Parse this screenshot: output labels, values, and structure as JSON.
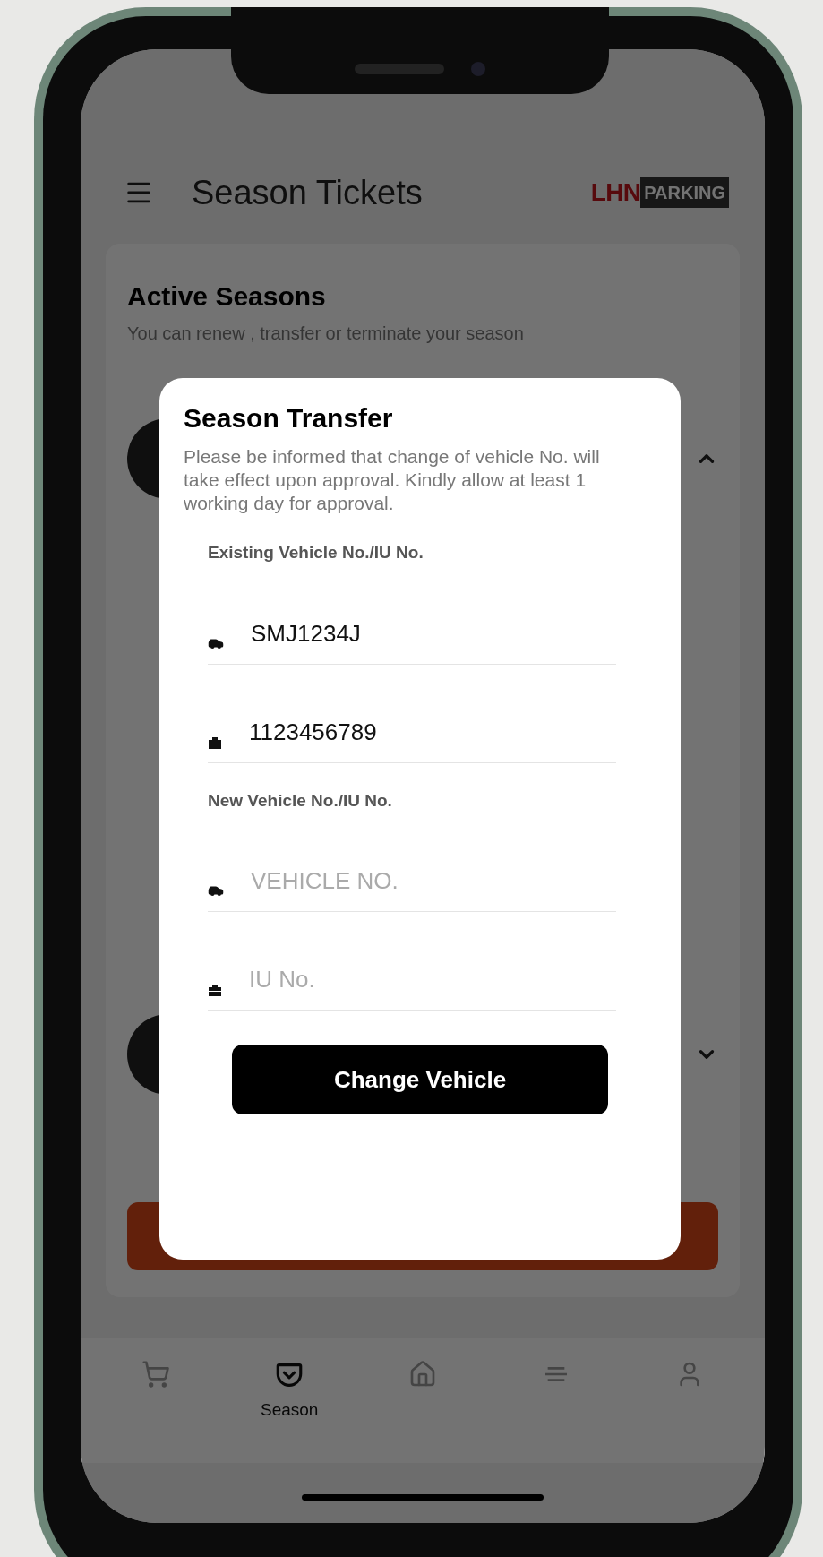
{
  "header": {
    "title": "Season Tickets",
    "logo": {
      "part_1": "LHN",
      "part_2": "PARKING"
    }
  },
  "card": {
    "title": "Active Seasons",
    "subtitle": "You can renew , transfer or terminate your season"
  },
  "seasons": [
    {
      "expanded": true
    },
    {
      "expanded": false
    }
  ],
  "dialog": {
    "title": "Season Transfer",
    "message": "Please be informed that change of vehicle No. will take effect upon approval. Kindly allow at least 1 working day for approval.",
    "sections": [
      {
        "label": "Existing Vehicle No./IU No.",
        "fields": [
          {
            "kind": "vehicle",
            "value": "SMJ1234J"
          },
          {
            "kind": "iu",
            "value": "1123456789"
          }
        ]
      },
      {
        "label": "New Vehicle No./IU No.",
        "fields": [
          {
            "kind": "vehicle",
            "placeholder": "VEHICLE NO."
          },
          {
            "kind": "iu",
            "placeholder": "IU No."
          }
        ]
      }
    ],
    "button": "Change Vehicle"
  },
  "nav": [
    {
      "kind": "cart",
      "selected": false
    },
    {
      "kind": "pocket",
      "label": "Season",
      "selected": true
    },
    {
      "kind": "home",
      "selected": false
    },
    {
      "kind": "stack",
      "selected": false
    },
    {
      "kind": "user",
      "selected": false
    }
  ]
}
